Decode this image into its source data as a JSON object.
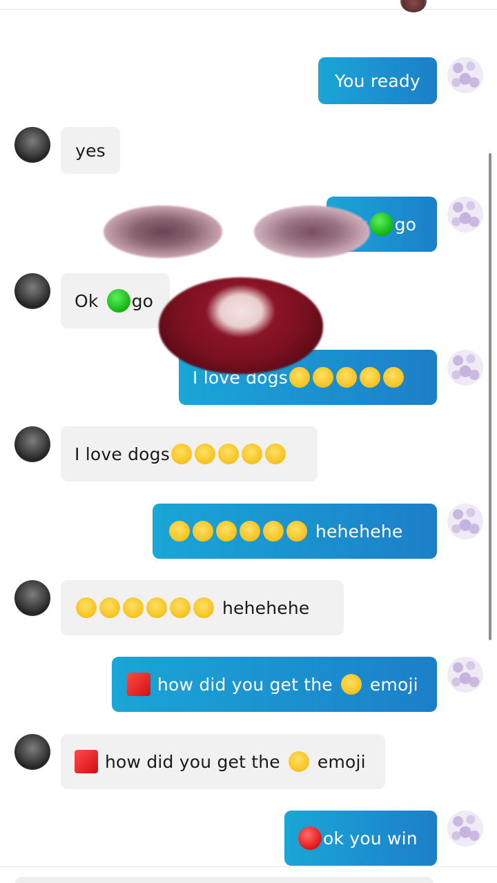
{
  "messages": [
    {
      "dir": "out",
      "text": "You ready"
    },
    {
      "dir": "in",
      "text": "yes"
    },
    {
      "dir": "out",
      "pre": "Ok",
      "text": "go",
      "icon": "green-circle-emoji"
    },
    {
      "dir": "in",
      "pre": "Ok",
      "text": "go",
      "icon": "green-circle-emoji"
    },
    {
      "dir": "out",
      "text": "I love dogs",
      "emojis": [
        "flushed-face-emoji",
        "face-without-mouth-emoji",
        "smirking-face-emoji",
        "crying-face-emoji",
        "face-with-steam-emoji"
      ]
    },
    {
      "dir": "in",
      "text": "I love dogs",
      "emojis": [
        "flushed-face-emoji",
        "face-without-mouth-emoji",
        "smirking-face-emoji",
        "crying-face-emoji",
        "face-with-steam-emoji"
      ]
    },
    {
      "dir": "out",
      "text": "hehehehe",
      "emojis": [
        "crying-face-emoji",
        "tired-face-emoji",
        "woozy-face-emoji",
        "woozy-face-emoji",
        "nerd-face-emoji",
        "face-blowing-kiss-emoji"
      ]
    },
    {
      "dir": "in",
      "text": "hehehehe",
      "emojis": [
        "crying-face-emoji",
        "tired-face-emoji",
        "woozy-face-emoji",
        "woozy-face-emoji",
        "nerd-face-emoji",
        "face-blowing-kiss-emoji"
      ]
    },
    {
      "dir": "out",
      "text1": "how did you get the",
      "text2": "emoji",
      "icon": "red-square-emoji",
      "mid": "tired-face-emoji"
    },
    {
      "dir": "in",
      "text1": "how did you get the",
      "text2": "emoji",
      "icon": "red-square-emoji",
      "mid": "tired-face-emoji"
    },
    {
      "dir": "out",
      "text": "ok you win",
      "icon": "red-circle-emoji"
    }
  ],
  "colors": {
    "outgoing_start": "#1aa6d6",
    "outgoing_end": "#1c7fc9",
    "incoming": "#f1f1f2"
  }
}
